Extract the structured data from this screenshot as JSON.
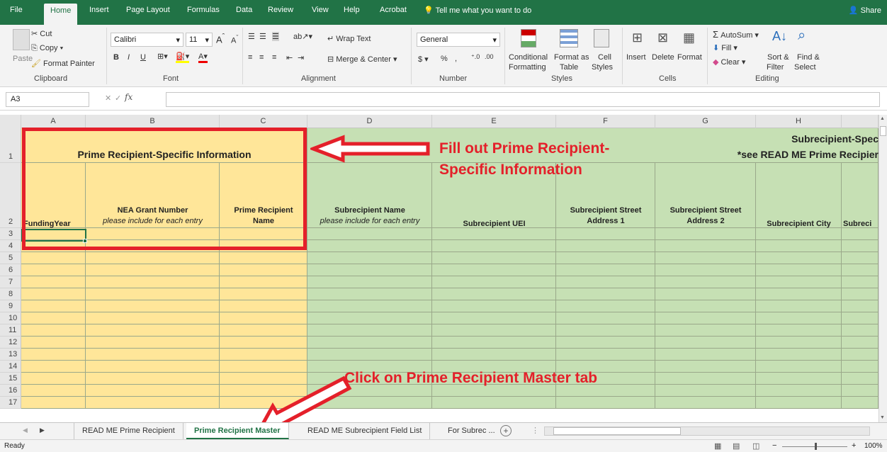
{
  "menu": {
    "tabs": [
      "File",
      "Home",
      "Insert",
      "Page Layout",
      "Formulas",
      "Data",
      "Review",
      "View",
      "Help",
      "Acrobat"
    ],
    "tell_me": "Tell me what you want to do",
    "share": "Share"
  },
  "ribbon": {
    "clipboard": {
      "paste": "Paste",
      "cut": "Cut",
      "copy": "Copy",
      "format_painter": "Format Painter",
      "group": "Clipboard"
    },
    "font": {
      "name": "Calibri",
      "size": "11",
      "group": "Font"
    },
    "alignment": {
      "wrap": "Wrap Text",
      "merge": "Merge & Center",
      "group": "Alignment"
    },
    "number": {
      "format": "General",
      "group": "Number"
    },
    "styles": {
      "conditional": "Conditional",
      "conditional2": "Formatting",
      "format_table": "Format as",
      "format_table2": "Table",
      "cell_styles": "Cell",
      "cell_styles2": "Styles",
      "group": "Styles"
    },
    "cells": {
      "insert": "Insert",
      "delete": "Delete",
      "format": "Format",
      "group": "Cells"
    },
    "editing": {
      "autosum": "AutoSum",
      "fill": "Fill",
      "clear": "Clear",
      "sort": "Sort &",
      "sort2": "Filter",
      "find": "Find &",
      "find2": "Select",
      "group": "Editing"
    }
  },
  "formula_bar": {
    "name_box": "A3",
    "fx": "fx",
    "value": ""
  },
  "columns": [
    "A",
    "B",
    "C",
    "D",
    "E",
    "F",
    "G",
    "H"
  ],
  "rows": [
    "1",
    "2",
    "3",
    "4",
    "5",
    "6",
    "7",
    "8",
    "9",
    "10",
    "11",
    "12",
    "13",
    "14",
    "15",
    "16",
    "17"
  ],
  "headers": {
    "prime_title": "Prime Recipient-Specific Information",
    "sub_title": "Subrecipient-Spec",
    "sub_note": "*see READ ME Prime Recipier",
    "funding_year": "FundingYear",
    "nea_grant": "NEA Grant Number",
    "nea_note": "please include for each entry",
    "prime_name_1": "Prime Recipient",
    "prime_name_2": "Name",
    "sub_name": "Subrecipient Name",
    "sub_name_note": "please include for each entry",
    "sub_uei": "Subrecipient UEI",
    "addr1_a": "Subrecipient Street",
    "addr1_b": "Address 1",
    "addr2_a": "Subrecipient Street",
    "addr2_b": "Address 2",
    "sub_city": "Subrecipient City",
    "sub_trunc": "Subreci"
  },
  "annotations": {
    "fill_out_1": "Fill out Prime Recipient-",
    "fill_out_2": "Specific Information",
    "click_tab": "Click on Prime Recipient Master tab"
  },
  "sheet_tabs": [
    "READ ME Prime Recipient",
    "Prime Recipient Master",
    "READ ME Subrecipient Field List",
    "For Subrec ..."
  ],
  "active_sheet": "Prime Recipient Master",
  "status": {
    "ready": "Ready",
    "zoom": "100%"
  },
  "colors": {
    "excel_green": "#217346",
    "prime_fill": "#ffe699",
    "sub_fill": "#c6e0b4",
    "annotation_red": "#e4202a"
  }
}
